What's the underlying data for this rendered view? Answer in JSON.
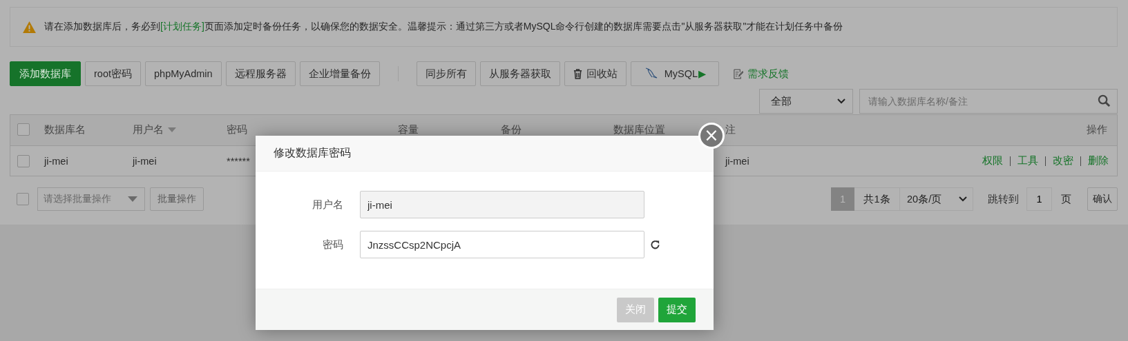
{
  "alert": {
    "before": "请在添加数据库后，务必到",
    "link": "[计划任务]",
    "after": "页面添加定时备份任务，以确保您的数据安全。温馨提示：通过第三方或者MySQL命令行创建的数据库需要点击\"从服务器获取\"才能在计划任务中备份"
  },
  "toolbar": {
    "left": [
      {
        "label": "添加数据库",
        "kind": "primary"
      },
      {
        "label": "root密码",
        "kind": "plain"
      },
      {
        "label": "phpMyAdmin",
        "kind": "plain"
      },
      {
        "label": "远程服务器",
        "kind": "plain"
      },
      {
        "label": "企业增量备份",
        "kind": "plain"
      }
    ],
    "right": [
      {
        "label": "同步所有",
        "kind": "plain"
      },
      {
        "label": "从服务器获取",
        "kind": "plain"
      },
      {
        "label": "回收站",
        "kind": "trash"
      },
      {
        "label": "MySQL",
        "play": "▶",
        "kind": "mysql"
      }
    ],
    "feedback": "需求反馈"
  },
  "filter": {
    "select": "全部",
    "search_placeholder": "请输入数据库名称/备注"
  },
  "table": {
    "select_all": {
      "checked": false
    },
    "columns": [
      {
        "label": "数据库名",
        "sortable": false
      },
      {
        "label": "用户名",
        "sortable": true
      },
      {
        "label": "密码",
        "sortable": false
      },
      {
        "label": "容量",
        "sortable": false
      },
      {
        "label": "备份",
        "sortable": false
      },
      {
        "label": "数据库位置",
        "sortable": false
      },
      {
        "label": "注",
        "sortable": false
      },
      {
        "label": "操作",
        "sortable": false
      }
    ],
    "rows": [
      {
        "checked": false,
        "cells": [
          "ji-mei",
          "ji-mei",
          "******"
        ],
        "remark": "ji-mei",
        "actions": [
          "权限",
          "工具",
          "改密",
          "删除"
        ]
      }
    ]
  },
  "footer": {
    "checked": false,
    "batch_placeholder": "请选择批量操作",
    "batch_button": "批量操作",
    "pagination": {
      "pages": [
        {
          "label": "1",
          "selected": true
        }
      ],
      "total": "共1条",
      "page_size": "20条/页",
      "goto_label": "跳转到",
      "goto_value": "1",
      "page_unit": "页",
      "confirm": "确认"
    }
  },
  "dialog": {
    "title": "修改数据库密码",
    "close": "×",
    "fields": [
      {
        "label": "用户名",
        "value": "ji-mei",
        "readonly": true,
        "refresh": false
      },
      {
        "label": "密码",
        "value": "JnzssCCsp2NCpcjA",
        "readonly": false,
        "refresh": true
      }
    ],
    "buttons": [
      {
        "label": "关闭",
        "kind": "secondary"
      },
      {
        "label": "提交",
        "kind": "primary"
      }
    ]
  }
}
